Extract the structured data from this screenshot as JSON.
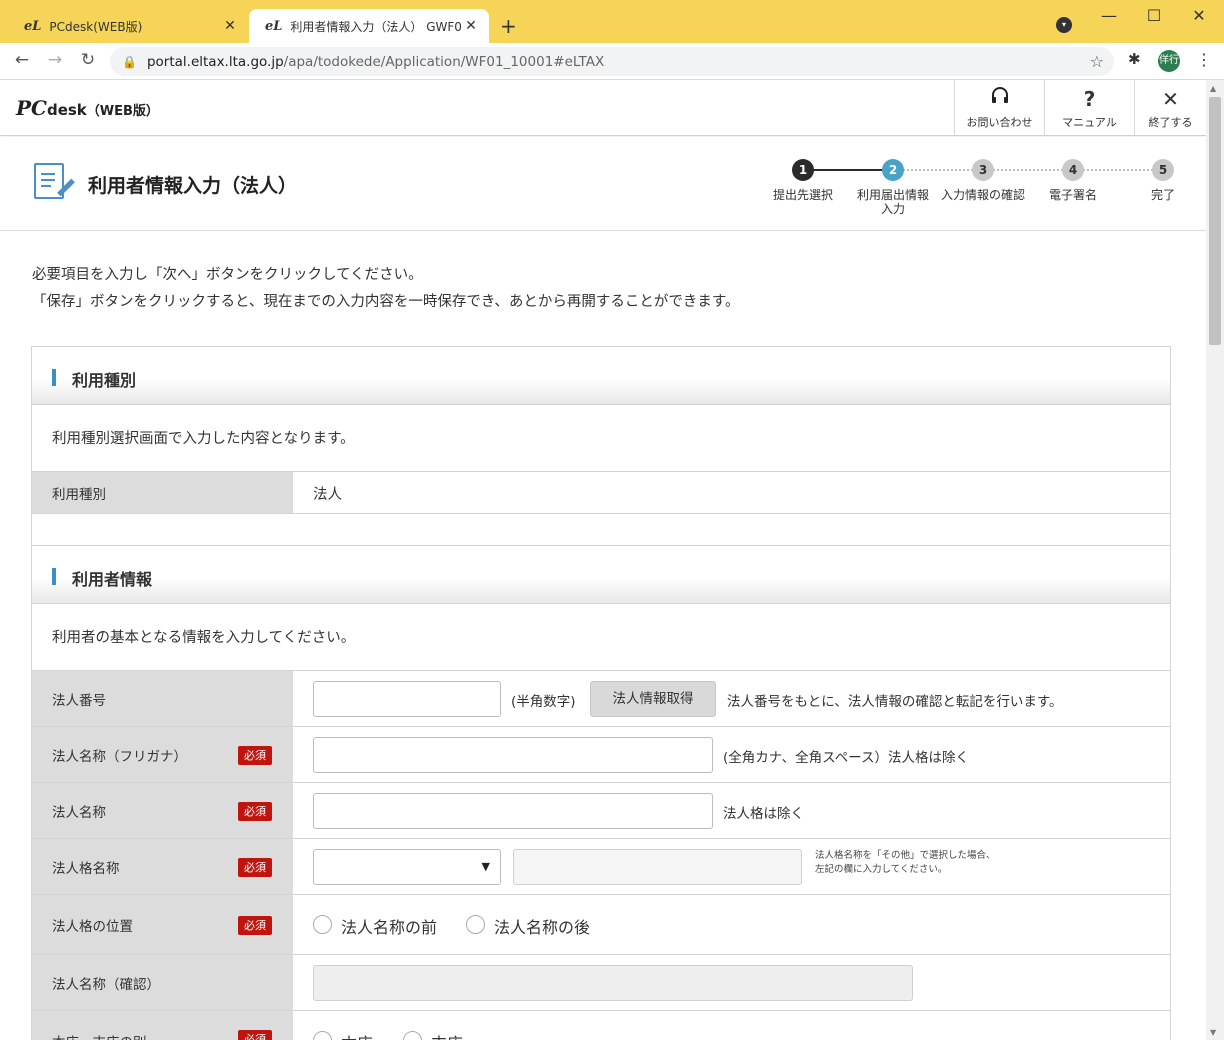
{
  "browser": {
    "tabs": [
      {
        "logo": "eL",
        "title": "PCdesk(WEB版)",
        "close": "✕"
      },
      {
        "logo": "eL",
        "title": "利用者情報入力（法人） GWF0",
        "close": "✕"
      }
    ],
    "new_tab": "+",
    "window": {
      "minimize": "—",
      "maximize": "☐",
      "close": "✕"
    },
    "url_host": "portal.eltax.lta.go.jp",
    "url_path": "/apa/todokede/Application/WF01_10001#eLTAX",
    "avatar": "佯行"
  },
  "app_header": {
    "brand_pc": "PC",
    "brand_desk": "desk",
    "brand_web": "（WEB版）",
    "buttons": [
      {
        "icon": "headset-icon",
        "glyph": "🎧",
        "label": "お問い合わせ"
      },
      {
        "icon": "help-icon",
        "glyph": "?",
        "label": "マニュアル"
      },
      {
        "icon": "close-icon",
        "glyph": "✕",
        "label": "終了する"
      }
    ]
  },
  "page": {
    "title": "利用者情報入力（法人）",
    "steps": [
      {
        "number": "1",
        "label": "提出先選択",
        "state": "done"
      },
      {
        "number": "2",
        "label": "利用届出情報\n入力",
        "state": "current"
      },
      {
        "number": "3",
        "label": "入力情報の確認",
        "state": "todo"
      },
      {
        "number": "4",
        "label": "電子署名",
        "state": "todo"
      },
      {
        "number": "5",
        "label": "完了",
        "state": "todo"
      }
    ],
    "intro_line1": "必要項目を入力し「次へ」ボタンをクリックしてください。",
    "intro_line2": "「保存」ボタンをクリックすると、現在までの入力内容を一時保存でき、あとから再開することができます。"
  },
  "section1": {
    "heading": "利用種別",
    "description": "利用種別選択画面で入力した内容となります。",
    "row_label": "利用種別",
    "row_value": "法人"
  },
  "section2": {
    "heading": "利用者情報",
    "description": "利用者の基本となる情報を入力してください。",
    "required_badge": "必須",
    "corp_number": {
      "label": "法人番号",
      "hint": "(半角数字)",
      "button": "法人情報取得",
      "note": "法人番号をもとに、法人情報の確認と転記を行います。"
    },
    "corp_name_kana": {
      "label": "法人名称（フリガナ）",
      "note": "(全角カナ、全角スペース）法人格は除く"
    },
    "corp_name": {
      "label": "法人名称",
      "note": "法人格は除く"
    },
    "corp_type": {
      "label": "法人格名称",
      "note_line1": "法人格名称を「その他」で選択した場合、",
      "note_line2": "左記の欄に入力してください。"
    },
    "corp_position": {
      "label": "法人格の位置",
      "option1": "法人名称の前",
      "option2": "法人名称の後"
    },
    "corp_confirm": {
      "label": "法人名称（確認）"
    },
    "branch": {
      "label": "本店・支店の別",
      "option1": "本店",
      "option2": "支店"
    }
  },
  "colors": {
    "tabbar": "#f5d458",
    "accent_blue": "#3a8fc4",
    "step_current": "#49a3c9",
    "step_done": "#2b2b2b",
    "step_todo": "#c8c8c8",
    "required_red": "#c0140f"
  }
}
